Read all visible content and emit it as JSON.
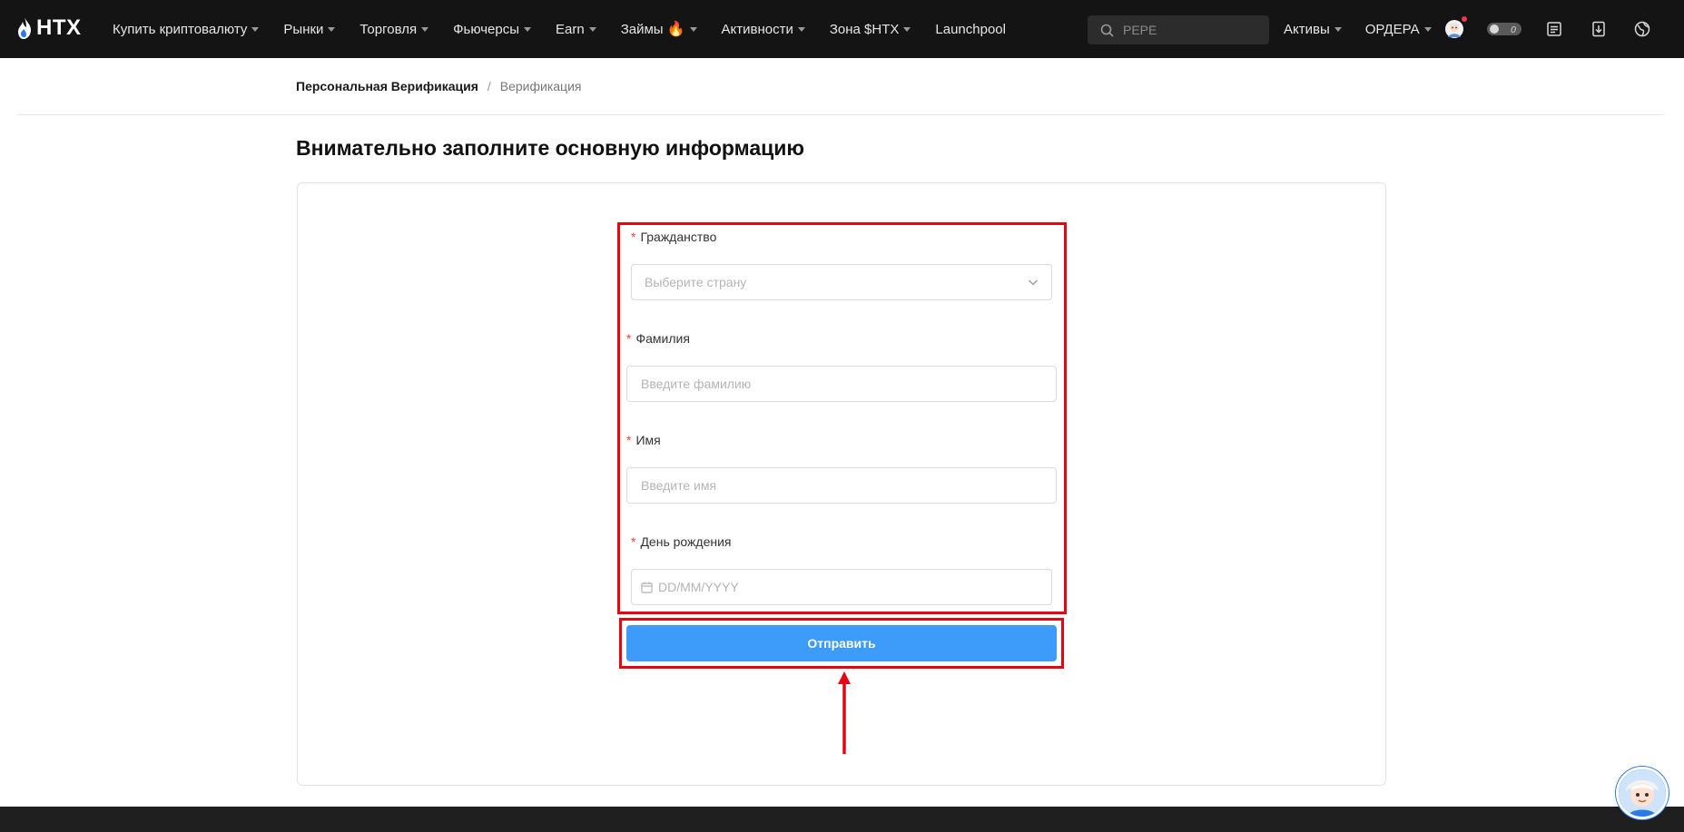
{
  "brand": {
    "name": "HTX",
    "flame_color": "#2c7be5"
  },
  "nav": {
    "items": [
      {
        "label": "Купить криптовалюту",
        "has_caret": true
      },
      {
        "label": "Рынки",
        "has_caret": true
      },
      {
        "label": "Торговля",
        "has_caret": true
      },
      {
        "label": "Фьючерсы",
        "has_caret": true
      },
      {
        "label": "Earn",
        "has_caret": true
      },
      {
        "label": "Займы",
        "has_caret": true,
        "badge": "🔥"
      },
      {
        "label": "Активности",
        "has_caret": true
      },
      {
        "label": "Зона $HTX",
        "has_caret": true
      },
      {
        "label": "Launchpool",
        "has_caret": false
      }
    ]
  },
  "search": {
    "placeholder": "PEPE",
    "icon": "search-icon"
  },
  "right_nav": {
    "assets_label": "Активы",
    "orders_label": "ОРДЕРА",
    "icons": [
      "avatar-icon",
      "toggle-icon",
      "announcements-icon",
      "download-icon",
      "language-icon"
    ]
  },
  "breadcrumb": {
    "current": "Персональная Верификация",
    "separator": "/",
    "next": "Верификация"
  },
  "page": {
    "title": "Внимательно заполните основную информацию"
  },
  "form": {
    "required_mark": "*",
    "citizenship": {
      "label": "Гражданство",
      "placeholder": "Выберите страну"
    },
    "last_name": {
      "label": "Фамилия",
      "placeholder": "Введите фамилию"
    },
    "first_name": {
      "label": "Имя",
      "placeholder": "Введите имя"
    },
    "birthday": {
      "label": "День рождения",
      "placeholder": "DD/MM/YYYY"
    },
    "submit_label": "Отправить"
  },
  "colors": {
    "accent": "#3d9bfa",
    "highlight": "#e30613",
    "required": "#e9433b",
    "topbar": "#141414"
  }
}
